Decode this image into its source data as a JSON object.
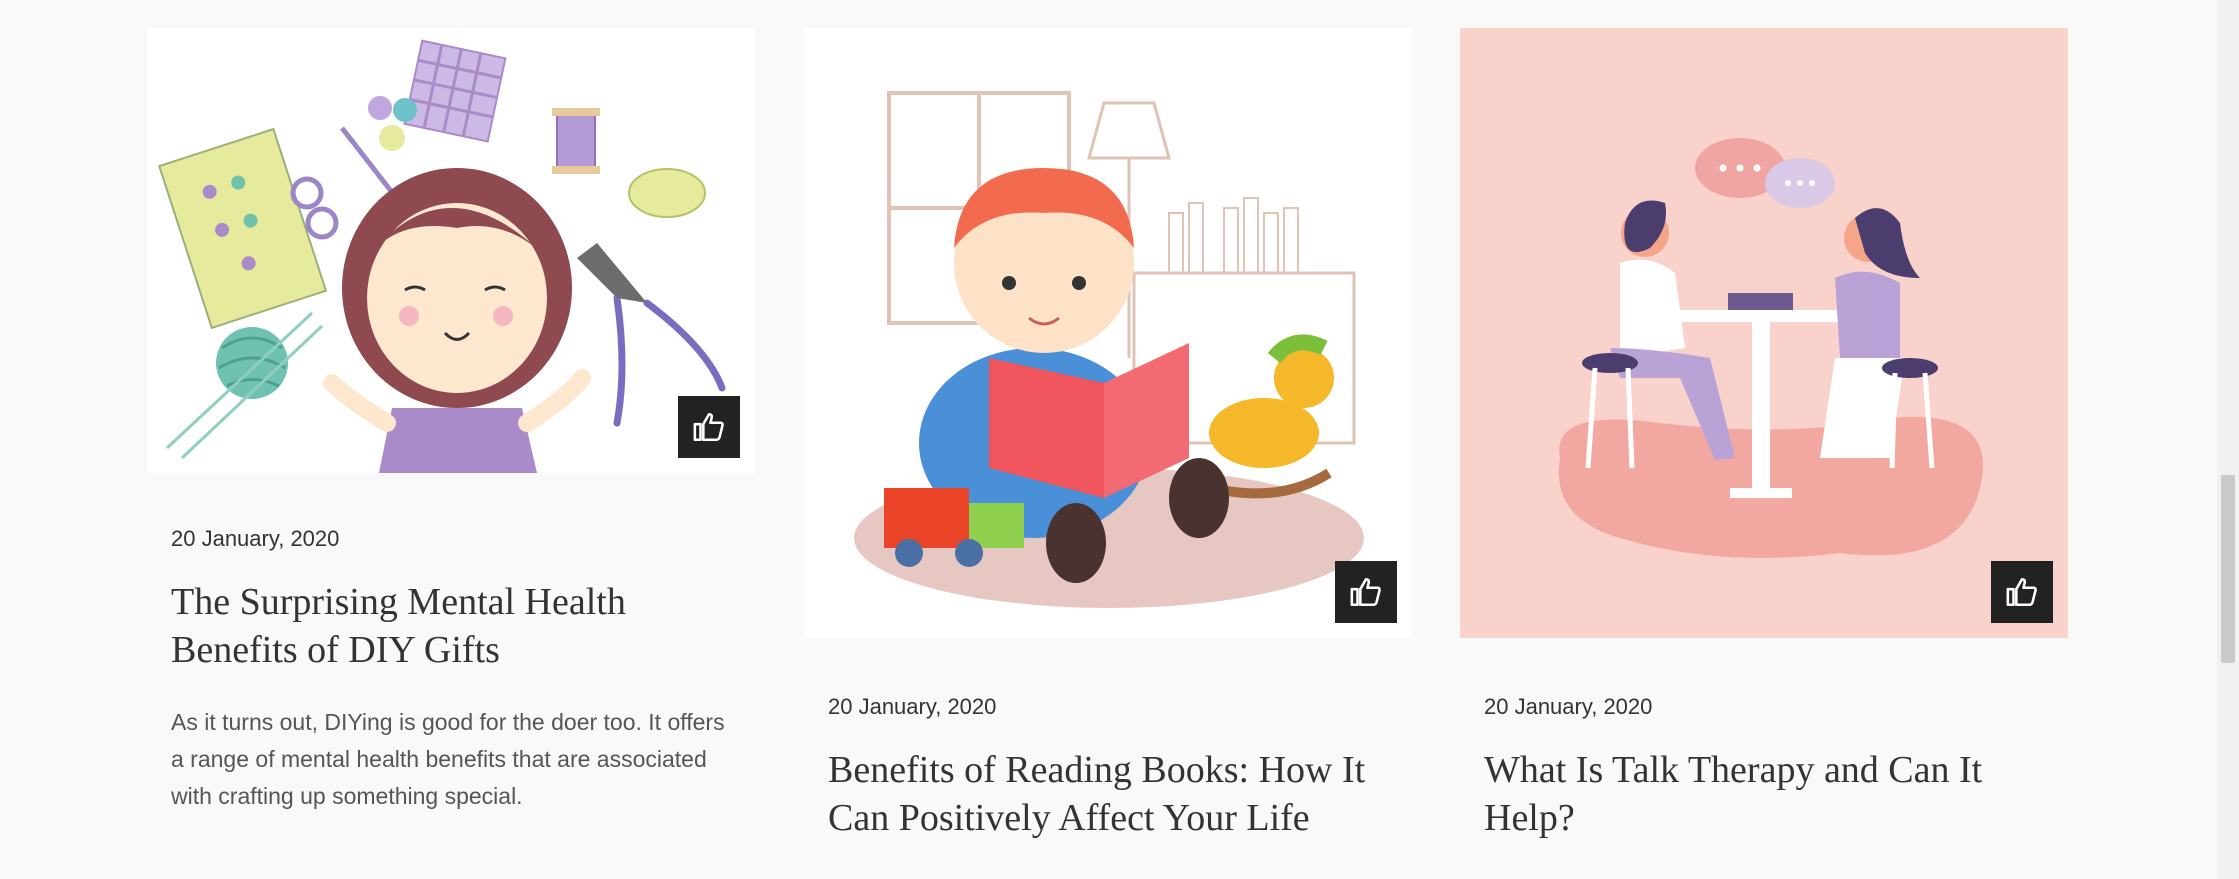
{
  "posts": [
    {
      "date": "20 January, 2020",
      "title": "The Surprising Mental Health Benefits of DIY Gifts",
      "excerpt": "As it turns out, DIYing is good for the doer too. It offers a range of mental health benefits that are associated with crafting up something special.",
      "image": "girl-with-craft-supplies-illustration",
      "like_icon": "thumbs-up-icon"
    },
    {
      "date": "20 January, 2020",
      "title": "Benefits of Reading Books: How It Can Positively Affect Your Life",
      "image": "boy-reading-book-illustration",
      "like_icon": "thumbs-up-icon"
    },
    {
      "date": "20 January, 2020",
      "title": "What Is Talk Therapy and Can It Help?",
      "image": "two-women-talking-illustration",
      "like_icon": "thumbs-up-icon"
    }
  ],
  "colors": {
    "background": "#f9f9f9",
    "like_button": "#222222",
    "therapy_image_bg": "#f9d3cb",
    "text": "#333333"
  }
}
